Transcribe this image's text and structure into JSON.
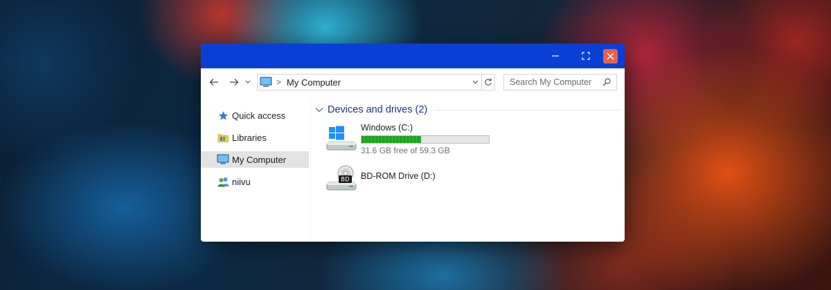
{
  "window": {
    "accent_color": "#0a3fd6",
    "close_color": "#e8624a"
  },
  "icons": {
    "back": "arrow-left-icon",
    "forward": "arrow-right-icon",
    "recent": "chevron-down-icon",
    "computer": "computer-icon",
    "refresh": "refresh-icon",
    "search": "search-icon",
    "minimize": "minimize-icon",
    "maximize": "maximize-icon",
    "close": "close-icon"
  },
  "address": {
    "separator": ">",
    "path": "My Computer"
  },
  "search": {
    "placeholder": "Search My Computer"
  },
  "sidebar": {
    "items": [
      {
        "label": "Quick access",
        "icon": "star-icon"
      },
      {
        "label": "Libraries",
        "icon": "libraries-folder-icon"
      },
      {
        "label": "My Computer",
        "icon": "computer-icon",
        "selected": true
      },
      {
        "label": "niivu",
        "icon": "users-icon"
      }
    ]
  },
  "content": {
    "group_title": "Devices and drives (2)",
    "drives": [
      {
        "name": "Windows (C:)",
        "free_text": "31.6 GB free of 59.3 GB",
        "used_fraction": 0.467,
        "icon": "windows-drive-icon"
      },
      {
        "name": "BD-ROM Drive (D:)",
        "icon": "bd-rom-drive-icon",
        "badge": "BD"
      }
    ]
  }
}
